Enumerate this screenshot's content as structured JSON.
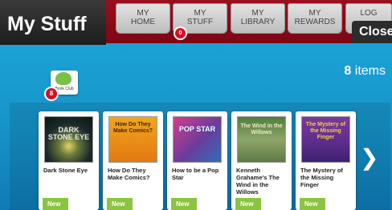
{
  "header": {
    "title": "My Stuff",
    "tabs": [
      {
        "line1": "MY",
        "line2": "HOME"
      },
      {
        "line1": "MY",
        "line2": "STUFF",
        "badge": "0"
      },
      {
        "line1": "MY",
        "line2": "LIBRARY"
      },
      {
        "line1": "MY",
        "line2": "REWARDS"
      },
      {
        "line1": "LOG",
        "line2": ""
      }
    ],
    "close_label": "Close"
  },
  "book_club": {
    "label": "Book Club",
    "badge": "8"
  },
  "items": {
    "count": "8",
    "suffix": "items"
  },
  "books": [
    {
      "title": "Dark Stone Eye",
      "cover_text": "DARK STONE EYE",
      "tag": "New"
    },
    {
      "title": "How Do They Make Comics?",
      "cover_text": "How Do They Make Comics?",
      "tag": "New"
    },
    {
      "title": "How to be a Pop Star",
      "cover_text": "POP STAR",
      "tag": "New"
    },
    {
      "title": "Kenneth Grahame's The Wind in the Willows",
      "cover_text": "The Wind in the Willows",
      "tag": "New"
    },
    {
      "title": "The Mystery of the Missing Finger",
      "cover_text": "The Mystery of the Missing Finger",
      "tag": "New"
    }
  ],
  "colors": {
    "header_red": "#8a0a18",
    "panel_blue": "#1a9fd6",
    "new_green": "#8bc43f",
    "badge_red": "#d50f25"
  },
  "icons": {
    "next": "chevron-right-icon"
  }
}
